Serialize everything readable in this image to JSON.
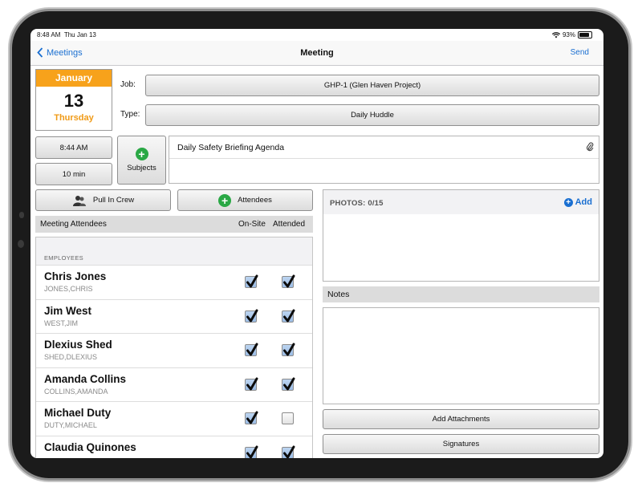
{
  "status_bar": {
    "time": "8:48 AM",
    "date": "Thu Jan 13",
    "battery": "93%"
  },
  "nav": {
    "back_label": "Meetings",
    "title": "Meeting",
    "send_label": "Send"
  },
  "calendar": {
    "month": "January",
    "day": "13",
    "weekday": "Thursday"
  },
  "job": {
    "label": "Job:",
    "value": "GHP-1 (Glen Haven Project)"
  },
  "type": {
    "label": "Type:",
    "value": "Daily Huddle"
  },
  "time_button": "8:44 AM",
  "duration_button": "10 min",
  "subjects_button": "Subjects",
  "agenda_text": "Daily Safety Briefing Agenda",
  "pull_in_crew_button": "Pull In Crew",
  "attendees_button": "Attendees",
  "table": {
    "col_attendees": "Meeting Attendees",
    "col_onsite": "On-Site",
    "col_attended": "Attended",
    "section": "EMPLOYEES",
    "rows": [
      {
        "name": "Chris Jones",
        "sub": "JONES,CHRIS",
        "onsite": true,
        "attended": true
      },
      {
        "name": "Jim West",
        "sub": "WEST,JIM",
        "onsite": true,
        "attended": true
      },
      {
        "name": "Dlexius Shed",
        "sub": "SHED,DLEXIUS",
        "onsite": true,
        "attended": true
      },
      {
        "name": "Amanda Collins",
        "sub": "COLLINS,AMANDA",
        "onsite": true,
        "attended": true
      },
      {
        "name": "Michael Duty",
        "sub": "DUTY,MICHAEL",
        "onsite": true,
        "attended": false
      },
      {
        "name": "Claudia Quinones",
        "sub": "",
        "onsite": true,
        "attended": true
      }
    ]
  },
  "photos": {
    "title": "PHOTOS: 0/15",
    "add_label": "Add"
  },
  "notes_label": "Notes",
  "add_attachments_button": "Add Attachments",
  "signatures_button": "Signatures",
  "colors": {
    "accent": "#1a6fd1",
    "calendar_header": "#f7a21b",
    "plus_green": "#2aa845"
  }
}
